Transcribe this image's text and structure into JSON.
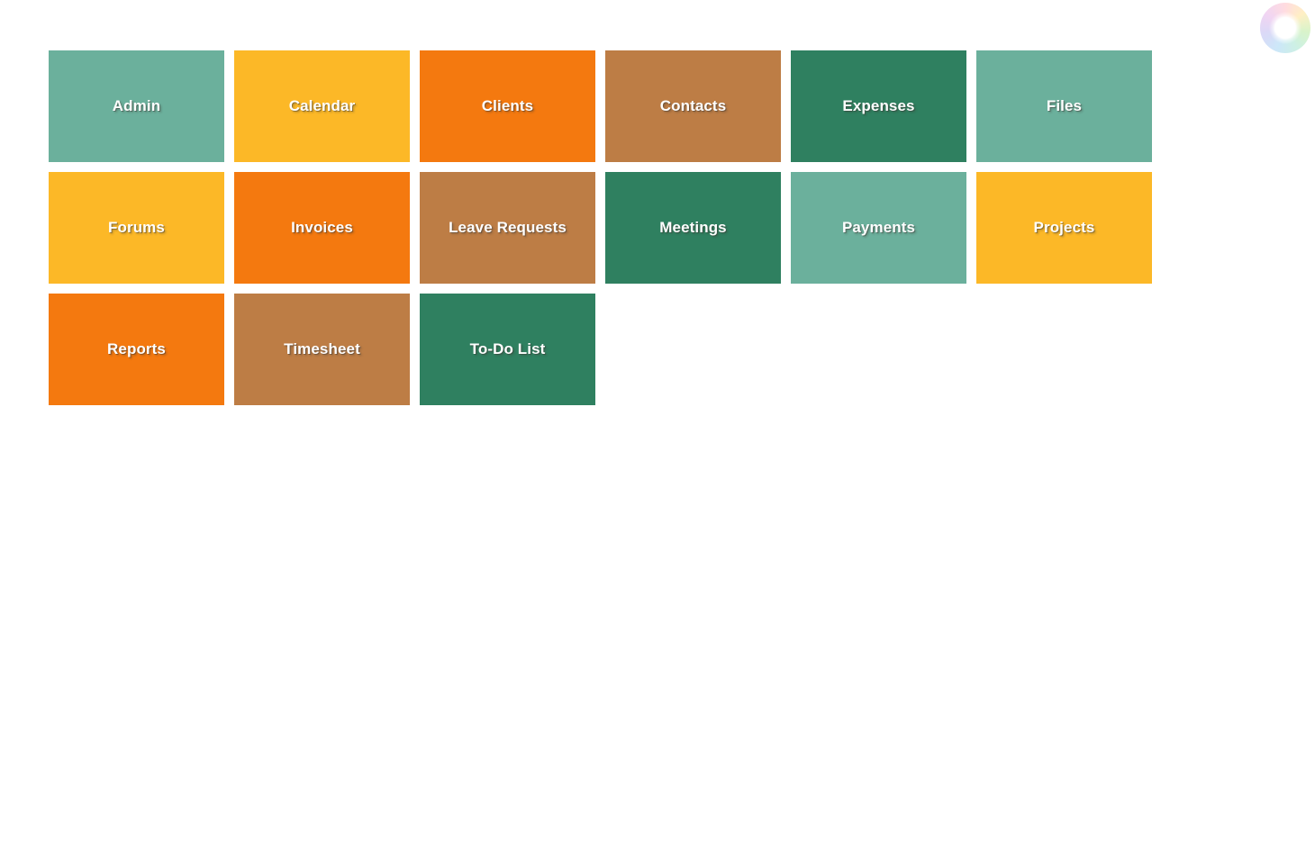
{
  "page": {
    "background_color": "#ffffff",
    "title": "Module Tiles"
  },
  "spinner": {
    "name": "color-wheel-spinner",
    "icon": "color-wheel-icon",
    "center_color": "#ffffff"
  },
  "palette": {
    "light_teal": "#6bb09c",
    "amber": "#fcb827",
    "orange": "#f4790f",
    "brown": "#bd7d45",
    "dark_teal": "#2f8060",
    "label_color": "#ffffff"
  },
  "tile_grid": {
    "columns": 6,
    "rows": 3,
    "tiles": [
      {
        "label": "Admin",
        "color": "#6bb09c",
        "name": "tile-admin"
      },
      {
        "label": "Calendar",
        "color": "#fcb827",
        "name": "tile-calendar"
      },
      {
        "label": "Clients",
        "color": "#f4790f",
        "name": "tile-clients"
      },
      {
        "label": "Contacts",
        "color": "#bd7d45",
        "name": "tile-contacts"
      },
      {
        "label": "Expenses",
        "color": "#2f8060",
        "name": "tile-expenses"
      },
      {
        "label": "Files",
        "color": "#6bb09c",
        "name": "tile-files"
      },
      {
        "label": "Forums",
        "color": "#fcb827",
        "name": "tile-forums"
      },
      {
        "label": "Invoices",
        "color": "#f4790f",
        "name": "tile-invoices"
      },
      {
        "label": "Leave Requests",
        "color": "#bd7d45",
        "name": "tile-leave-requests"
      },
      {
        "label": "Meetings",
        "color": "#2f8060",
        "name": "tile-meetings"
      },
      {
        "label": "Payments",
        "color": "#6bb09c",
        "name": "tile-payments"
      },
      {
        "label": "Projects",
        "color": "#fcb827",
        "name": "tile-projects"
      },
      {
        "label": "Reports",
        "color": "#f4790f",
        "name": "tile-reports"
      },
      {
        "label": "Timesheet",
        "color": "#bd7d45",
        "name": "tile-timesheet"
      },
      {
        "label": "To-Do List",
        "color": "#2f8060",
        "name": "tile-todo-list"
      }
    ]
  }
}
